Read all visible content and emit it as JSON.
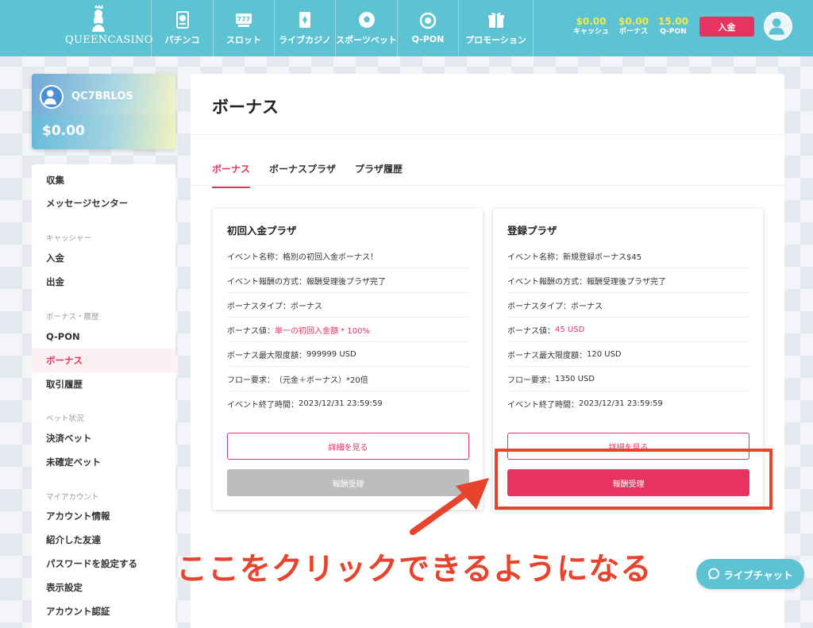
{
  "brand": {
    "logo_text": "QUEENCASINO"
  },
  "nav": [
    {
      "label": "パチンコ",
      "icon": "pachinko-icon"
    },
    {
      "label": "スロット",
      "icon": "slot-icon"
    },
    {
      "label": "ライブカジノ",
      "icon": "live-casino-icon"
    },
    {
      "label": "スポーツベット",
      "icon": "soccer-ball-icon"
    },
    {
      "label": "Q-PON",
      "icon": "qpon-icon"
    },
    {
      "label": "プロモーション",
      "icon": "gift-icon"
    }
  ],
  "balances": [
    {
      "amount": "$0.00",
      "label": "キャッシュ"
    },
    {
      "amount": "$0.00",
      "label": "ボーナス"
    },
    {
      "amount": "15.00",
      "label": "Q-PON"
    }
  ],
  "header": {
    "deposit_label": "入金"
  },
  "profile": {
    "username": "QC7BRLOS",
    "balance": "$0.00"
  },
  "sidebar": {
    "items": [
      {
        "type": "item",
        "label": "収集"
      },
      {
        "type": "item",
        "label": "メッセージセンター"
      },
      {
        "type": "section",
        "label": "キャッシャー"
      },
      {
        "type": "item",
        "label": "入金"
      },
      {
        "type": "item",
        "label": "出金"
      },
      {
        "type": "section",
        "label": "ボーナス・履歴"
      },
      {
        "type": "item",
        "label": "Q-PON"
      },
      {
        "type": "item",
        "label": "ボーナス",
        "active": true
      },
      {
        "type": "item",
        "label": "取引履歴"
      },
      {
        "type": "section",
        "label": "ベット状況"
      },
      {
        "type": "item",
        "label": "決済ベット"
      },
      {
        "type": "item",
        "label": "未確定ベット"
      },
      {
        "type": "section",
        "label": "マイアカウント"
      },
      {
        "type": "item",
        "label": "アカウント情報"
      },
      {
        "type": "item",
        "label": "紹介した友達"
      },
      {
        "type": "item",
        "label": "パスワードを設定する"
      },
      {
        "type": "item",
        "label": "表示設定"
      },
      {
        "type": "item",
        "label": "アカウント認証"
      }
    ]
  },
  "main": {
    "title": "ボーナス",
    "tabs": [
      {
        "label": "ボーナス",
        "active": true
      },
      {
        "label": "ボーナスプラザ"
      },
      {
        "label": "プラザ履歴"
      }
    ],
    "cards": [
      {
        "title": "初回入金プラザ",
        "rows": [
          {
            "label": "イベント名称：",
            "value": "格別の初回入金ボーナス！",
            "highlight": false
          },
          {
            "label": "イベント報酬の方式：",
            "value": "報酬受理後プラザ完了",
            "highlight": false
          },
          {
            "label": "ボーナスタイプ：",
            "value": "ボーナス",
            "highlight": false
          },
          {
            "label": "ボーナス値：",
            "value": "単一の初回入金額 * 100%",
            "highlight": true
          },
          {
            "label": "ボーナス最大限度額：",
            "value": "999999 USD",
            "highlight": false
          },
          {
            "label": "フロー要求：",
            "value": "（元金＋ボーナス）*20倍",
            "highlight": false
          },
          {
            "label": "イベント終了時間：",
            "value": "2023/12/31 23:59:59",
            "highlight": false
          }
        ],
        "details_label": "詳細を見る",
        "claim_label": "報酬受理",
        "claim_enabled": false
      },
      {
        "title": "登録プラザ",
        "rows": [
          {
            "label": "イベント名称：",
            "value": "新規登録ボーナス$45",
            "highlight": false
          },
          {
            "label": "イベント報酬の方式：",
            "value": "報酬受理後プラザ完了",
            "highlight": false
          },
          {
            "label": "ボーナスタイプ：",
            "value": "ボーナス",
            "highlight": false
          },
          {
            "label": "ボーナス値：",
            "value": "45 USD",
            "highlight": true
          },
          {
            "label": "ボーナス最大限度額：",
            "value": "120 USD",
            "highlight": false
          },
          {
            "label": "フロー要求：",
            "value": "1350 USD",
            "highlight": false
          },
          {
            "label": "イベント終了時間：",
            "value": "2023/12/31 23:59:59",
            "highlight": false
          }
        ],
        "details_label": "詳細を見る",
        "claim_label": "報酬受理",
        "claim_enabled": true
      }
    ]
  },
  "annotation": {
    "text": "ここをクリックできるようになる",
    "color": "#e8432d"
  },
  "chat": {
    "label": "ライブチャット"
  },
  "colors": {
    "accent": "#e8325f",
    "header": "#5dc3d2",
    "balance": "#f6e84b"
  }
}
